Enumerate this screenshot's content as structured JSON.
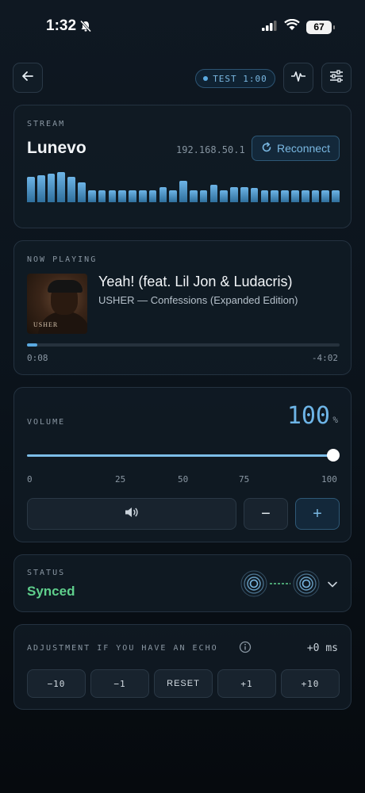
{
  "status_bar": {
    "time": "1:32",
    "battery": "67"
  },
  "toolbar": {
    "test_label": "TEST 1:00"
  },
  "stream": {
    "label": "STREAM",
    "name": "Lunevo",
    "ip": "192.168.50.1",
    "reconnect_label": "Reconnect",
    "levels": [
      0.75,
      0.8,
      0.85,
      0.9,
      0.75,
      0.6,
      0.35,
      0.35,
      0.35,
      0.35,
      0.35,
      0.35,
      0.35,
      0.45,
      0.35,
      0.65,
      0.35,
      0.35,
      0.52,
      0.35,
      0.45,
      0.45,
      0.42,
      0.35,
      0.35,
      0.35,
      0.35,
      0.35,
      0.35,
      0.35,
      0.35
    ]
  },
  "now_playing": {
    "label": "NOW PLAYING",
    "cover_text": "USHER",
    "title": "Yeah! (feat. Lil Jon & Ludacris)",
    "artist": "USHER — Confessions (Expanded Edition)",
    "elapsed": "0:08",
    "remaining": "-4:02",
    "progress": 0.032
  },
  "volume": {
    "label": "VOLUME",
    "value": "100",
    "unit": "%",
    "level": 1.0,
    "ticks": [
      "0",
      "25",
      "50",
      "75",
      "100"
    ],
    "minus_label": "−",
    "plus_label": "+"
  },
  "status": {
    "label": "STATUS",
    "value": "Synced"
  },
  "echo": {
    "label": "ADJUSTMENT IF YOU HAVE AN ECHO",
    "value": "+0 ms",
    "buttons": [
      "−10",
      "−1",
      "RESET",
      "+1",
      "+10"
    ]
  },
  "colors": {
    "accent": "#5aa9e0",
    "synced": "#5fcf8c",
    "background": "#0b131b"
  }
}
